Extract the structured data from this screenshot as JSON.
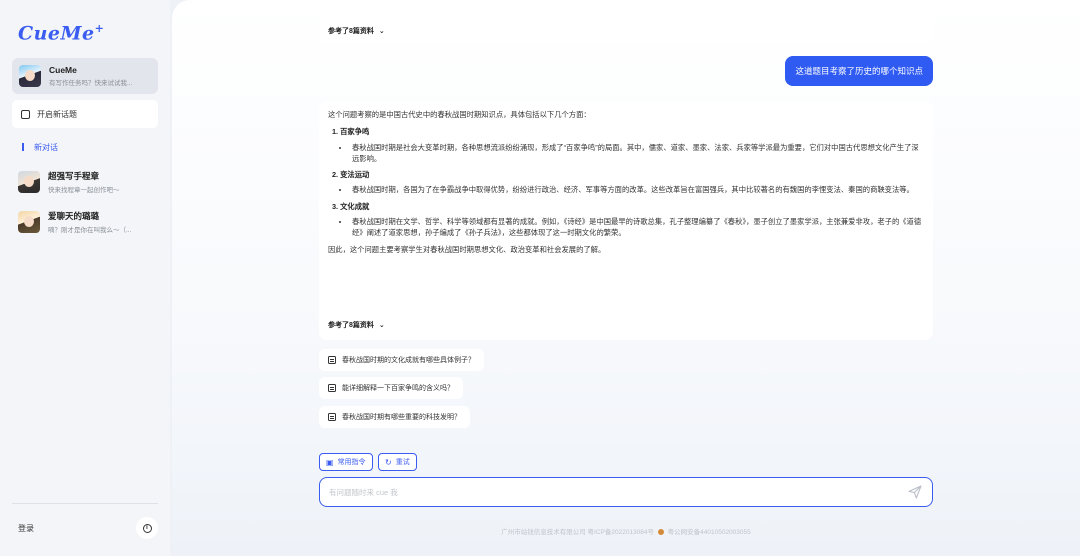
{
  "brand": {
    "logo": "CueMe",
    "logo_mark": "+"
  },
  "sidebar": {
    "bot": {
      "name": "CueMe",
      "subtitle": "有写作任务吗？快来试试我..."
    },
    "new_topic_label": "开启新话题",
    "new_chat_label": "新对话",
    "chats": [
      {
        "name": "超强写手程章",
        "subtitle": "快来找程章一起创作吧～"
      },
      {
        "name": "爱聊天的璐璐",
        "subtitle": "嘀？刚才是你在叫我么～（..."
      }
    ],
    "login_label": "登录"
  },
  "conversation": {
    "top_ref": "参考了8篇资料",
    "user_message": "这道题目考察了历史的哪个知识点",
    "answer": {
      "intro": "这个问题考察的是中国古代史中的春秋战国时期知识点，具体包括以下几个方面：",
      "sections": [
        {
          "heading": "1. 百家争鸣",
          "bullet": "春秋战国时期是社会大变革时期，各种思想流派纷纷涌现，形成了“百家争鸣”的局面。其中，儒家、道家、墨家、法家、兵家等学派最为重要，它们对中国古代思想文化产生了深远影响。"
        },
        {
          "heading": "2. 变法运动",
          "bullet": "春秋战国时期，各国为了在争霸战争中取得优势，纷纷进行政治、经济、军事等方面的改革。这些改革旨在富国强兵，其中比较著名的有魏国的李悝变法、秦国的商鞅变法等。"
        },
        {
          "heading": "3. 文化成就",
          "bullet": "春秋战国时期在文学、哲学、科学等领域都有显著的成就。例如，《诗经》是中国最早的诗歌总集，孔子整理编纂了《春秋》，墨子创立了墨家学派，主张兼爱非攻，老子的《道德经》阐述了道家思想，孙子编成了《孙子兵法》，这些都体现了这一时期文化的繁荣。"
        }
      ],
      "conclusion": "因此，这个问题主要考察学生对春秋战国时期思想文化、政治变革和社会发展的了解。",
      "ref": "参考了8篇资料"
    },
    "suggestions": [
      "春秋战国时期的文化成就有哪些具体例子？",
      "能详细解释一下百家争鸣的含义吗？",
      "春秋战国时期有哪些重要的科技发明？"
    ]
  },
  "composer": {
    "common_commands_label": "常用指令",
    "retry_label": "重试",
    "placeholder": "有问题随时来 cue 我"
  },
  "footer": {
    "company": "广州市站钱信息技术有限公司 粤ICP备2022013084号",
    "police": "粤公网安备44010502003055"
  }
}
